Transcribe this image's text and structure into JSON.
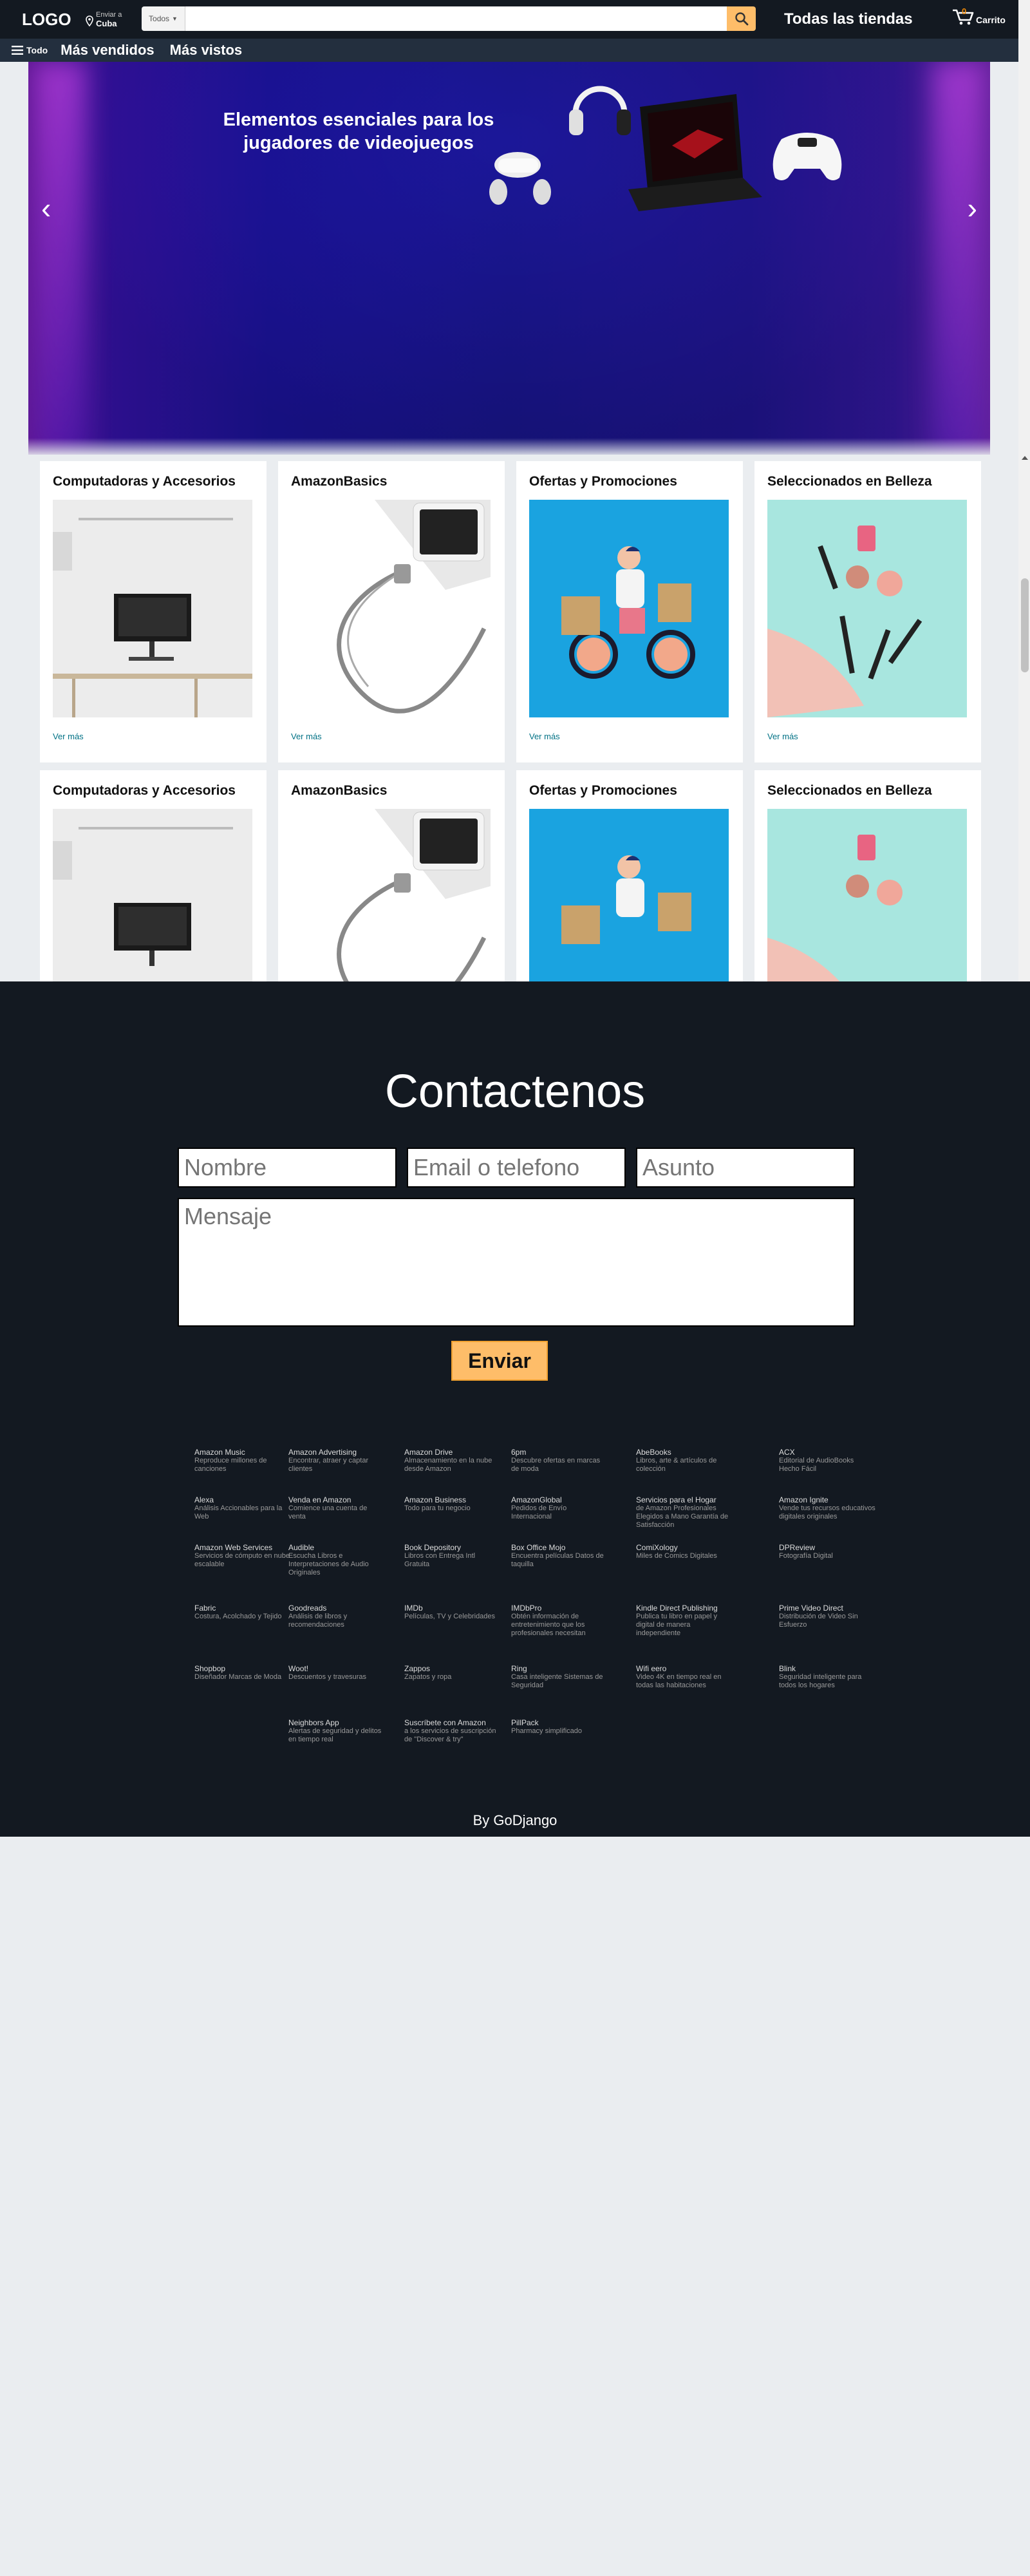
{
  "header": {
    "logo": "LOGO",
    "deliver_line1": "Enviar a",
    "deliver_line2": "Cuba",
    "search_category": "Todos",
    "search_value": "",
    "all_stores": "Todas las tiendas",
    "cart_count": "0",
    "cart_label": "Carrito"
  },
  "nav": {
    "all_label": "Todo",
    "items": [
      "Más vendidos",
      "Más vistos"
    ]
  },
  "hero": {
    "title": "Elementos esenciales para los jugadores de videojuegos",
    "prev": "‹",
    "next": "›"
  },
  "cards": [
    {
      "title": "Computadoras y Accesorios",
      "link": "Ver más"
    },
    {
      "title": "AmazonBasics",
      "link": "Ver más"
    },
    {
      "title": "Ofertas y Promociones",
      "link": "Ver más"
    },
    {
      "title": "Seleccionados en Belleza",
      "link": "Ver más"
    }
  ],
  "contact": {
    "title": "Contactenos",
    "name_placeholder": "Nombre",
    "email_placeholder": "Email o telefono",
    "subject_placeholder": "Asunto",
    "message_placeholder": "Mensaje",
    "send": "Enviar"
  },
  "footer_links": [
    [
      {
        "title": "Amazon Music",
        "desc": "Reproduce millones de canciones"
      },
      {
        "title": "Amazon Advertising",
        "desc": "Encontrar, atraer y captar clientes"
      },
      {
        "title": "Amazon Drive",
        "desc": "Almacenamiento en la nube desde Amazon"
      },
      {
        "title": "6pm",
        "desc": "Descubre ofertas en marcas de moda"
      },
      {
        "title": "AbeBooks",
        "desc": "Libros, arte & artículos de colección"
      },
      {
        "title": "ACX",
        "desc": "Editorial de AudioBooks Hecho Fácil"
      }
    ],
    [
      {
        "title": "Alexa",
        "desc": "Análisis Accionables para la Web"
      },
      {
        "title": "Venda en Amazon",
        "desc": "Comience una cuenta de venta"
      },
      {
        "title": "Amazon Business",
        "desc": "Todo para tu negocio"
      },
      {
        "title": "AmazonGlobal",
        "desc": "Pedidos de Envío Internacional"
      },
      {
        "title": "Servicios para el Hogar",
        "desc": "de Amazon Profesionales Elegidos a Mano Garantía de Satisfacción"
      },
      {
        "title": "Amazon Ignite",
        "desc": "Vende tus recursos educativos digitales originales"
      }
    ],
    [
      {
        "title": "Amazon Web Services",
        "desc": "Servicios de cómputo en nube escalable"
      },
      {
        "title": "Audible",
        "desc": "Escucha Libros e Interpretaciones de Audio Originales"
      },
      {
        "title": "Book Depository",
        "desc": "Libros con Entrega Intl Gratuita"
      },
      {
        "title": "Box Office Mojo",
        "desc": "Encuentra películas Datos de taquilla"
      },
      {
        "title": "ComiXology",
        "desc": "Miles de Comics Digitales"
      },
      {
        "title": "DPReview",
        "desc": "Fotografía Digital"
      }
    ],
    [
      {
        "title": "Fabric",
        "desc": "Costura, Acolchado y Tejido"
      },
      {
        "title": "Goodreads",
        "desc": "Análisis de libros y recomendaciones"
      },
      {
        "title": "IMDb",
        "desc": "Películas, TV y Celebridades"
      },
      {
        "title": "IMDbPro",
        "desc": "Obtén información de entretenimiento que los profesionales necesitan"
      },
      {
        "title": "Kindle Direct Publishing",
        "desc": "Publica tu libro en papel y digital de manera independiente"
      },
      {
        "title": "Prime Video Direct",
        "desc": "Distribución de Video Sin Esfuerzo"
      }
    ],
    [
      {
        "title": "Shopbop",
        "desc": "Diseñador Marcas de Moda"
      },
      {
        "title": "Woot!",
        "desc": "Descuentos y travesuras"
      },
      {
        "title": "Zappos",
        "desc": "Zapatos y ropa"
      },
      {
        "title": "Ring",
        "desc": "Casa inteligente Sistemas de Seguridad"
      },
      {
        "title": "Wifi eero",
        "desc": "Video 4K en tiempo real en todas las habitaciones"
      },
      {
        "title": "Blink",
        "desc": "Seguridad inteligente para todos los hogares"
      }
    ],
    [
      {
        "title": "",
        "desc": ""
      },
      {
        "title": "Neighbors App",
        "desc": "Alertas de seguridad y delitos en tiempo real"
      },
      {
        "title": "Suscríbete con Amazon",
        "desc": "a los servicios de suscripción de \"Discover & try\""
      },
      {
        "title": "PillPack",
        "desc": "Pharmacy simplificado"
      },
      {
        "title": "",
        "desc": ""
      },
      {
        "title": "",
        "desc": ""
      }
    ]
  ],
  "byline": "By GoDjango"
}
